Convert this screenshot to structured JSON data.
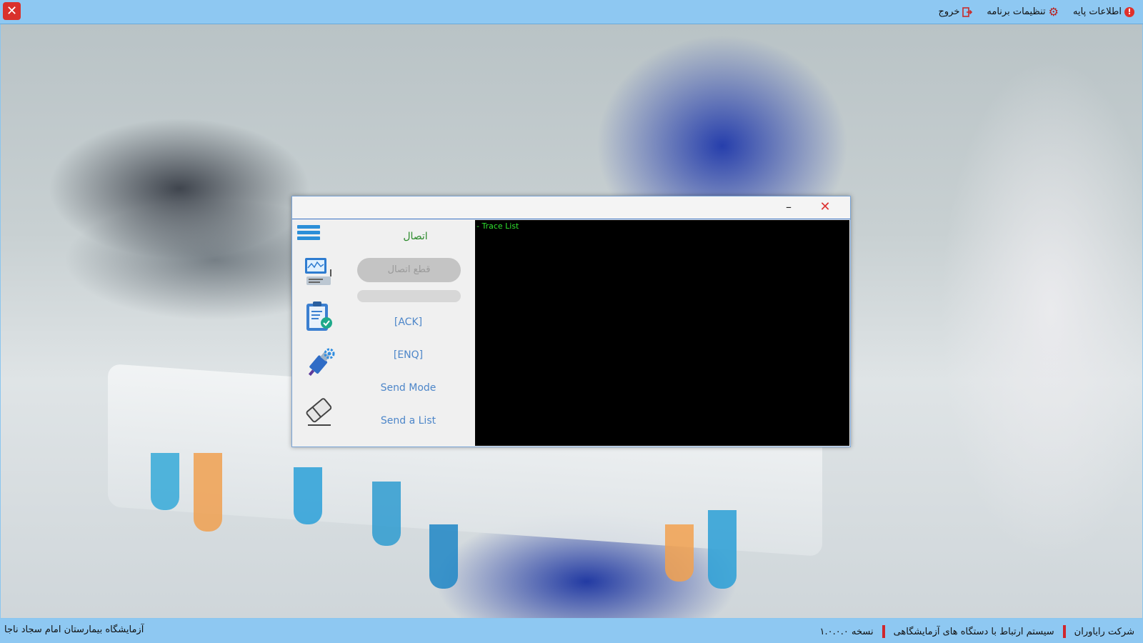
{
  "topbar": {
    "menu": [
      {
        "label": "اطلاعات پایه",
        "icon": "info-icon"
      },
      {
        "label": "تنظیمات برنامه",
        "icon": "gear-icon"
      },
      {
        "label": "خروج",
        "icon": "exit-icon"
      }
    ],
    "close_glyph": "✕"
  },
  "dialog": {
    "minimize_glyph": "–",
    "close_glyph": "✕",
    "connect_title": "اتصال",
    "disconnect_button": "قطع اتصال",
    "ack": "[ACK]",
    "enq": "[ENQ]",
    "send_mode": "Send Mode",
    "send_list": "Send a List",
    "trace_text": "- Trace List",
    "side_icons": [
      "monitor-device-icon",
      "clipboard-check-icon",
      "usb-gear-icon",
      "eraser-icon"
    ]
  },
  "status": {
    "left": "آزمایشگاه بیمارستان امام سجاد ناجا",
    "company": "شرکت رایاوران",
    "system": "سیستم ارتباط با دستگاه های آزمایشگاهی",
    "version": "نسخه ۱.۰.۰.۰"
  },
  "colors": {
    "bar": "#8ec8f2",
    "accent": "#2c8fd8",
    "connect_green": "#2b8a2b",
    "trace_green": "#2fe02f"
  }
}
